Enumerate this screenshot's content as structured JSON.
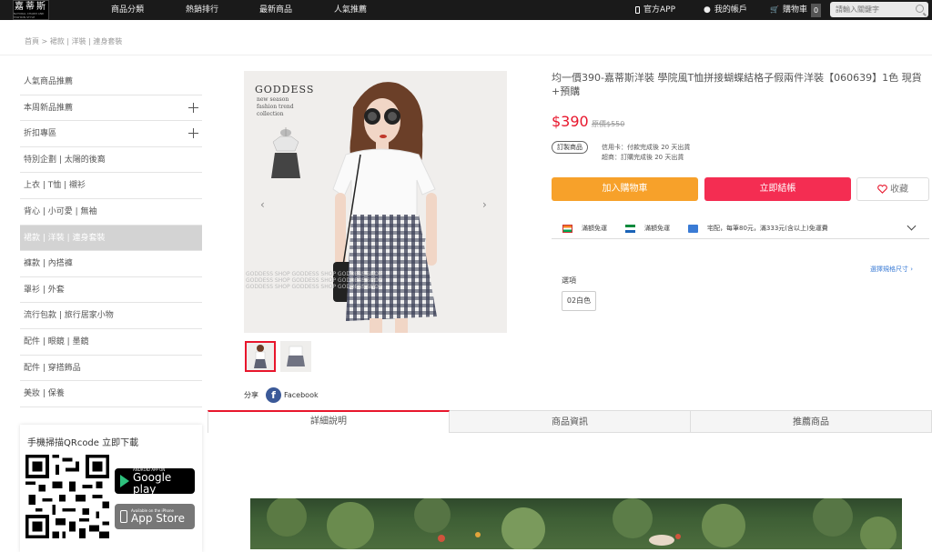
{
  "topbar": {
    "logo_text": "嘉蒂斯",
    "logo_sub": "NATURAL CHARM AND FASHION STYLE",
    "nav": [
      "商品分類",
      "熱銷排行",
      "最新商品",
      "人氣推薦"
    ],
    "app_label": "官方APP",
    "account_label": "我的帳戶",
    "cart_label": "購物車",
    "cart_count": "0",
    "search_placeholder": "請輸入關鍵字"
  },
  "breadcrumb": "首頁  >  裙款 | 洋裝 | 連身套裝",
  "sidebar": {
    "items": [
      {
        "label": "人氣商品推薦",
        "expandable": false,
        "active": false
      },
      {
        "label": "本周新品推薦",
        "expandable": true,
        "active": false
      },
      {
        "label": "折扣專區",
        "expandable": true,
        "active": false
      },
      {
        "label": "特別企劃 | 太陽的後裔",
        "expandable": false,
        "active": false
      },
      {
        "label": "上衣 | T恤 | 襯衫",
        "expandable": false,
        "active": false
      },
      {
        "label": "背心 | 小可愛 | 無袖",
        "expandable": false,
        "active": false
      },
      {
        "label": "裙款 | 洋裝 | 連身套裝",
        "expandable": false,
        "active": true
      },
      {
        "label": "褲款 | 內搭褲",
        "expandable": false,
        "active": false
      },
      {
        "label": "罩衫 | 外套",
        "expandable": false,
        "active": false
      },
      {
        "label": "流行包款 | 旅行居家小物",
        "expandable": false,
        "active": false
      },
      {
        "label": "配件 | 眼鏡 | 墨鏡",
        "expandable": false,
        "active": false
      },
      {
        "label": "配件 | 穿搭飾品",
        "expandable": false,
        "active": false
      },
      {
        "label": "美妝 | 保養",
        "expandable": false,
        "active": false
      }
    ],
    "qr_title": "手機掃描QRcode 立即下載",
    "google_small": "ANDROID APP ON",
    "google_big": "Google play",
    "apple_small": "Available on the iPhone",
    "apple_big": "App Store"
  },
  "gallery": {
    "brand": "GODDESS",
    "subtitle_lines": [
      "new season",
      "fashion trend",
      "collection"
    ],
    "watermark": "GODDESS  SHOP  GODDESS  SHOP  GODDESS  SHOP"
  },
  "share": {
    "label": "分享",
    "facebook": "Facebook"
  },
  "product": {
    "title": "均一價390-嘉蒂斯洋裝 學院風T恤拼接蝴蝶結格子假兩件洋裝【060639】1色 現貨+預購",
    "price": "$390",
    "old_price": "原價$550",
    "badge": "訂製商品",
    "ship_card": "信用卡：付款完成後 20 天出貨",
    "ship_store": "超商：訂購完成後 20 天出貨",
    "add_cart": "加入購物車",
    "buy_now": "立即結帳",
    "favorite": "收藏",
    "payments": [
      "滿額免運",
      "滿額免運",
      "宅配，每筆80元，滿333元(含以上)免運費"
    ],
    "size_guide": "選擇規格尺寸",
    "option_label": "選項",
    "option_value": "02白色"
  },
  "tabs": [
    "詳細說明",
    "商品資訊",
    "推薦商品"
  ]
}
